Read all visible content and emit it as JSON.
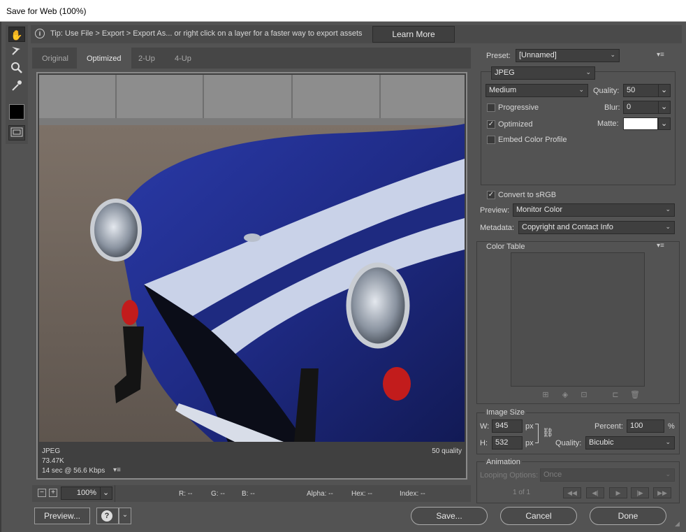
{
  "window": {
    "title": "Save for Web (100%)"
  },
  "tip": {
    "text": "Tip: Use File > Export > Export As...  or right click on a layer for a faster way to export assets",
    "button": "Learn More"
  },
  "tabs": [
    "Original",
    "Optimized",
    "2-Up",
    "4-Up"
  ],
  "active_tab": "Optimized",
  "image_info": {
    "format": "JPEG",
    "size": "73.47K",
    "time": "14 sec @ 56.6 Kbps",
    "quality": "50 quality"
  },
  "status": {
    "zoom": "100%",
    "r": "R: --",
    "g": "G: --",
    "b": "B: --",
    "alpha": "Alpha: --",
    "hex": "Hex: --",
    "index": "Index: --"
  },
  "preset": {
    "label": "Preset:",
    "value": "[Unnamed]"
  },
  "format": {
    "value": "JPEG"
  },
  "compression": {
    "value": "Medium"
  },
  "quality": {
    "label": "Quality:",
    "value": "50"
  },
  "blur": {
    "label": "Blur:",
    "value": "0"
  },
  "matte": {
    "label": "Matte:",
    "color": "#ffffff"
  },
  "options": {
    "progressive": {
      "label": "Progressive",
      "checked": false
    },
    "optimized": {
      "label": "Optimized",
      "checked": true
    },
    "embed": {
      "label": "Embed Color Profile",
      "checked": false
    },
    "srgb": {
      "label": "Convert to sRGB",
      "checked": true
    }
  },
  "preview_select": {
    "label": "Preview:",
    "value": "Monitor Color"
  },
  "metadata_select": {
    "label": "Metadata:",
    "value": "Copyright and Contact Info"
  },
  "color_table": {
    "title": "Color Table"
  },
  "image_size": {
    "title": "Image Size",
    "w_label": "W:",
    "w": "945",
    "h_label": "H:",
    "h": "532",
    "unit": "px",
    "percent_label": "Percent:",
    "percent": "100",
    "percent_unit": "%",
    "quality_label": "Quality:",
    "quality": "Bicubic"
  },
  "animation": {
    "title": "Animation",
    "looping_label": "Looping Options:",
    "looping": "Once",
    "frame": "1 of 1"
  },
  "buttons": {
    "preview": "Preview...",
    "save": "Save...",
    "cancel": "Cancel",
    "done": "Done"
  },
  "icons": {
    "hand": "hand-icon",
    "slice": "slice-select-icon",
    "zoom": "zoom-icon",
    "eyedropper": "eyedropper-icon",
    "help": "help-icon"
  }
}
